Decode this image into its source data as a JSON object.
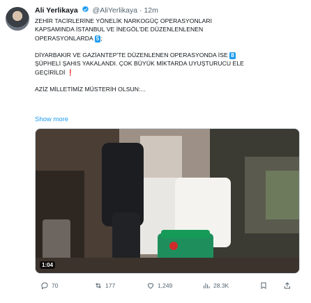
{
  "tweet": {
    "author_name": "Ali Yerlikaya",
    "handle": "@AliYerlikaya",
    "separator": "·",
    "time": "12m",
    "para1_a": "ZEHİR TACİRLERİNE YÖNELİK NARKOGÜÇ OPERASYONLARI",
    "para1_b": "KAPSAMINDA İSTANBUL VE İNEGÖL'DE DÜZENLENLENEN",
    "para1_c": "OPERASYONLARDA",
    "badge1": "5",
    "para1_end": ";",
    "para2_a": "DİYARBAKIR VE GAZİANTEP'TE DÜZENLENEN OPERASYONDA İSE",
    "badge2": "8",
    "para2_b": "ŞÜPHELİ ŞAHIS YAKALANDI. ÇOK BÜYÜK MİKTARDA UYUŞTURUCU ELE",
    "para2_c": "GEÇİRİLDİ",
    "exclaim": "❗",
    "para3": "AZİZ MİLLETİMİZ MÜSTERİH OLSUN:...",
    "show_more": "Show more",
    "video_duration": "1:04"
  },
  "actions": {
    "replies": "70",
    "reposts": "177",
    "likes": "1,249",
    "views": "28.3K"
  },
  "colors": {
    "accent": "#1d9bf0",
    "muted": "#536471"
  },
  "icons": [
    "verified-badge-icon",
    "reply-icon",
    "repost-icon",
    "like-icon",
    "views-icon",
    "bookmark-icon",
    "share-icon"
  ]
}
